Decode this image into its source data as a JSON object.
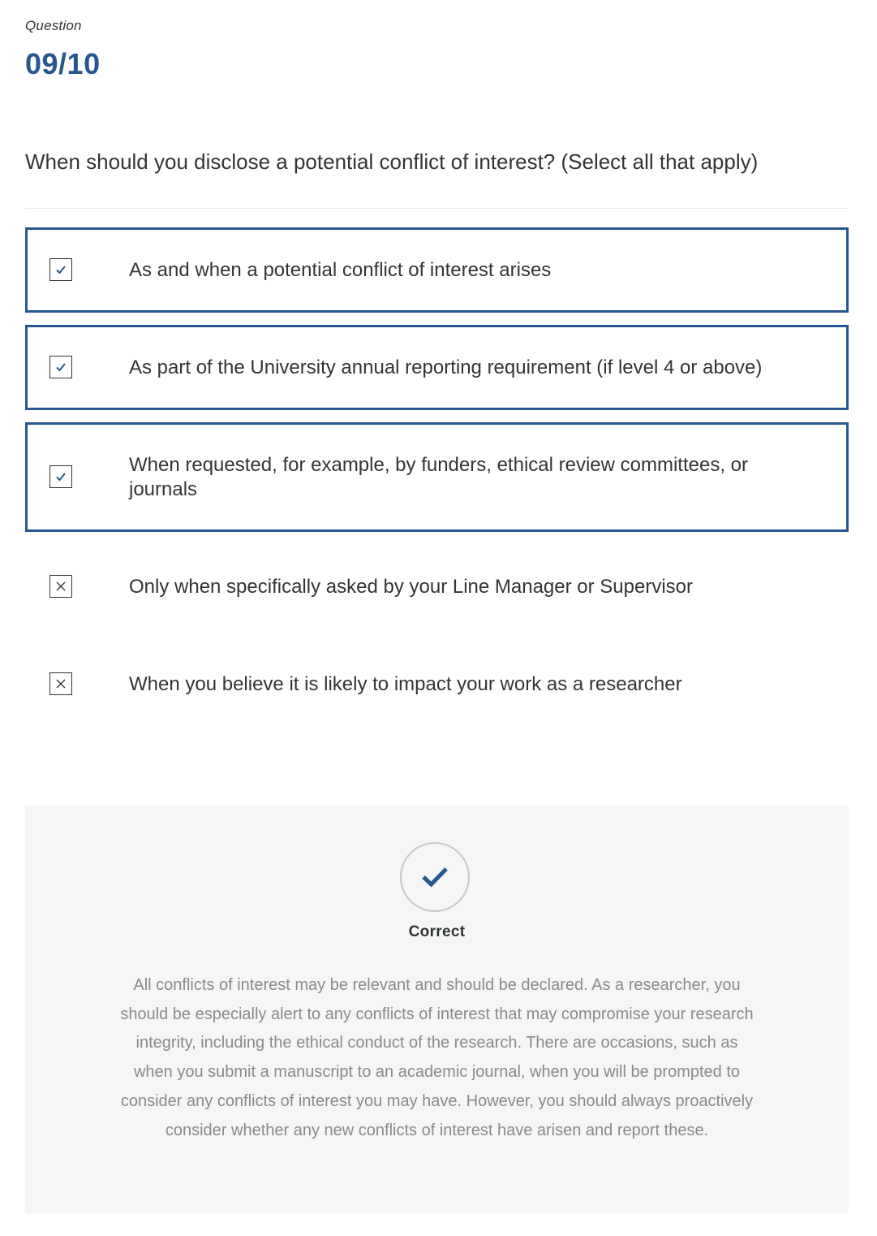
{
  "question": {
    "label": "Question",
    "counter": "09/10",
    "text": "When should you disclose a potential conflict of interest? (Select all that apply)"
  },
  "options": [
    {
      "text": "As and when a potential conflict of interest arises",
      "selected": true,
      "icon": "checkmark-icon"
    },
    {
      "text": "As part of the University annual reporting requirement (if level 4 or above)",
      "selected": true,
      "icon": "checkmark-icon"
    },
    {
      "text": "When requested, for example, by funders, ethical review committees, or journals",
      "selected": true,
      "icon": "checkmark-icon"
    },
    {
      "text": "Only when specifically asked by your Line Manager or Supervisor",
      "selected": false,
      "icon": "cross-icon"
    },
    {
      "text": "When you believe it is likely to impact your work as a researcher",
      "selected": false,
      "icon": "cross-icon"
    }
  ],
  "feedback": {
    "status": "Correct",
    "icon": "checkmark-circle-icon",
    "text": "All conflicts of interest may be relevant and should be declared. As a researcher, you should be especially alert to any conflicts of interest that may compromise your research integrity, including the ethical conduct of the research. There are occasions, such as when you submit a manuscript to an academic journal, when you will be prompted to consider any conflicts of interest you may have. However, you should always proactively consider whether any new conflicts of interest have arisen and report these."
  },
  "colors": {
    "accent": "#26578f",
    "text": "#313537",
    "feedback_bg": "#f6f6f6",
    "feedback_text": "#8a8a8a"
  }
}
